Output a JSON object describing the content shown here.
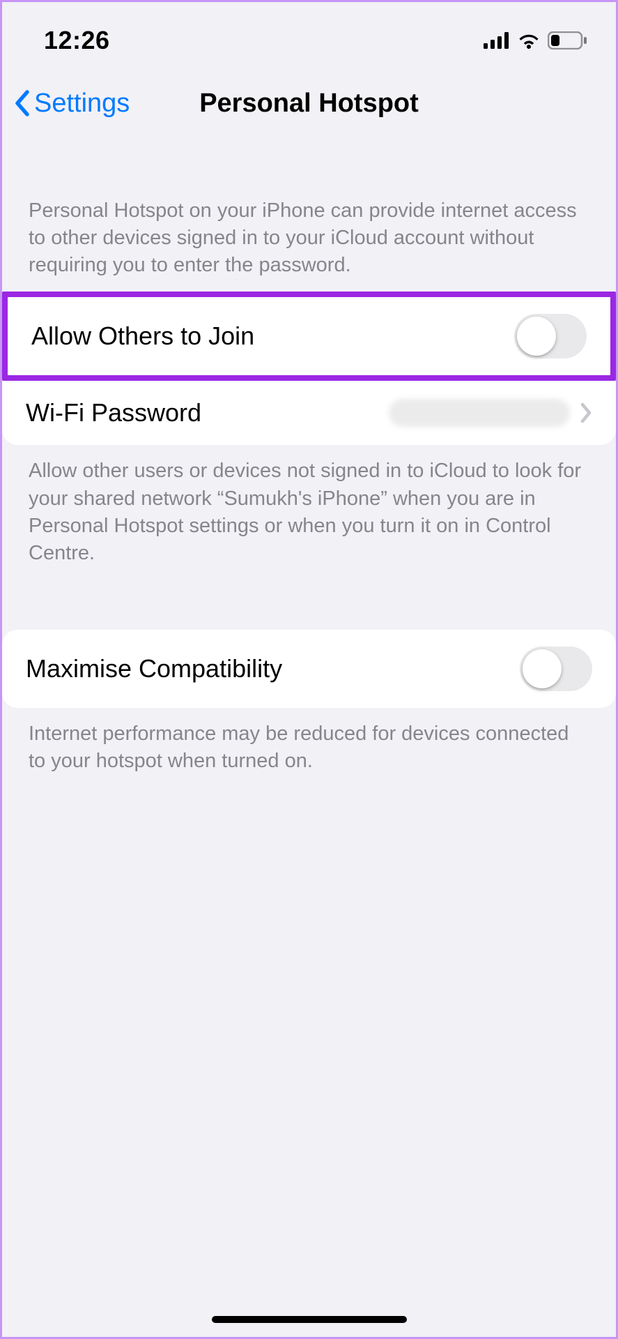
{
  "statusBar": {
    "time": "12:26"
  },
  "nav": {
    "back_label": "Settings",
    "title": "Personal Hotspot"
  },
  "section1": {
    "header": "Personal Hotspot on your iPhone can provide internet access to other devices signed in to your iCloud account without requiring you to enter the password.",
    "allow_label": "Allow Others to Join",
    "wifi_label": "Wi-Fi Password",
    "footer": "Allow other users or devices not signed in to iCloud to look for your shared network “Sumukh's iPhone” when you are in Personal Hotspot settings or when you turn it on in Control Centre."
  },
  "section2": {
    "maximise_label": "Maximise Compatibility",
    "footer": "Internet performance may be reduced for devices connected to your hotspot when turned on."
  }
}
